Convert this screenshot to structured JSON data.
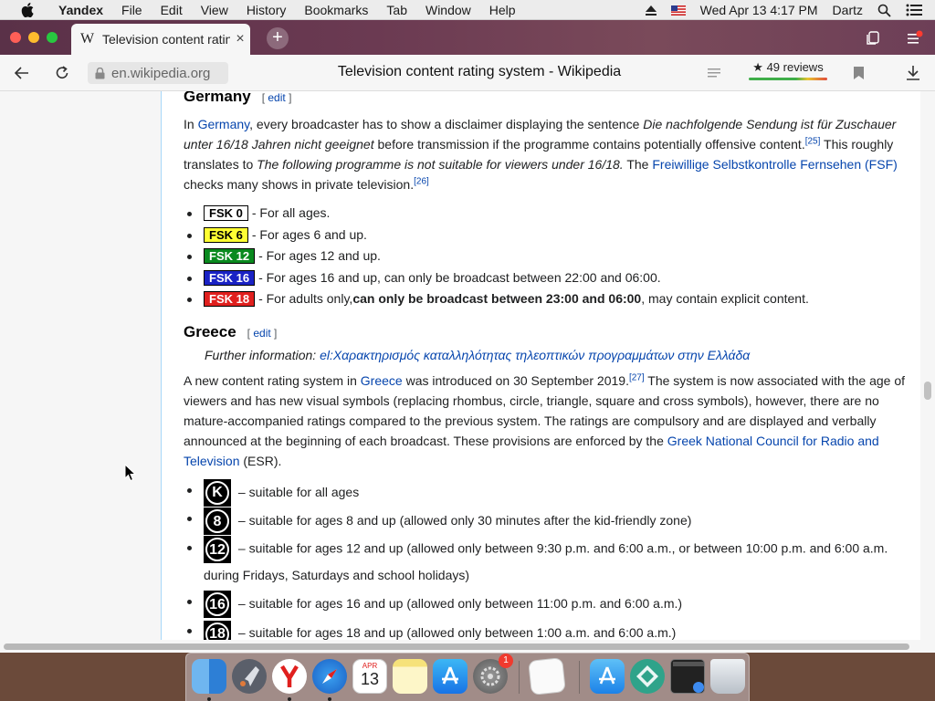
{
  "menubar": {
    "app_name": "Yandex",
    "items": [
      "File",
      "Edit",
      "View",
      "History",
      "Bookmarks",
      "Tab",
      "Window",
      "Help"
    ],
    "datetime": "Wed Apr 13  4:17 PM",
    "user": "Dartz"
  },
  "browser": {
    "tab_title": "Television content rating system - Wikipedia",
    "url": "en.wikipedia.org",
    "page_title": "Television content rating system - Wikipedia",
    "reviews": "★ 49 reviews"
  },
  "article": {
    "edit_label": "edit",
    "germany": {
      "heading": "Germany",
      "p_parts": {
        "in": "In ",
        "link_germany": "Germany",
        "t1": ", every broadcaster has to show a disclaimer displaying the sentence ",
        "quote_de": "Die nachfolgende Sendung ist für Zuschauer unter 16/18 Jahren nicht geeignet",
        "t2": " before transmission if the programme contains potentially offensive content.",
        "ref25": "[25]",
        "t3": " This roughly translates to ",
        "quote_en": "The following programme is not suitable for viewers under 16/18.",
        "t4": " The ",
        "link_fsf": "Freiwillige Selbstkontrolle Fernsehen (FSF)",
        "t5": " checks many shows in private television.",
        "ref26": "[26]"
      },
      "ratings": [
        {
          "label": "FSK 0",
          "bg": "#ffffff",
          "fg": "#000000",
          "desc": " - For all ages.",
          "bold": "",
          "tail": ""
        },
        {
          "label": "FSK 6",
          "bg": "#ffff33",
          "fg": "#000000",
          "desc": " - For ages 6 and up.",
          "bold": "",
          "tail": ""
        },
        {
          "label": "FSK 12",
          "bg": "#0a8a1f",
          "fg": "#ffffff",
          "desc": " - For ages 12 and up.",
          "bold": "",
          "tail": ""
        },
        {
          "label": "FSK 16",
          "bg": "#1a22c4",
          "fg": "#ffffff",
          "desc": " - For ages 16 and up, can only be broadcast between 22:00 and 06:00.",
          "bold": "",
          "tail": ""
        },
        {
          "label": "FSK 18",
          "bg": "#e0201e",
          "fg": "#ffffff",
          "desc": " - For adults only, ",
          "bold": "can only be broadcast between 23:00 and 06:00",
          "tail": ", may contain explicit content."
        }
      ]
    },
    "greece": {
      "heading": "Greece",
      "further_label": "Further information: ",
      "further_link": "el:Χαρακτηρισμός καταλληλότητας τηλεοπτικών προγραμμάτων στην Ελλάδα",
      "p_parts": {
        "t1": "A new content rating system in ",
        "link_greece": "Greece",
        "t2": " was introduced on 30 September 2019.",
        "ref27": "[27]",
        "t3": " The system is now associated with the age of viewers and has new visual symbols (replacing rhombus, circle, triangle, square and cross symbols), however, there are no mature-accompanied ratings compared to the previous system. The ratings are compulsory and are displayed and verbally announced at the beginning of each broadcast. These provisions are enforced by the ",
        "link_esr": "Greek National Council for Radio and Television",
        "t4": " (ESR)."
      },
      "ratings": [
        {
          "symbol": "K",
          "desc": " – suitable for all ages"
        },
        {
          "symbol": "8",
          "desc": " – suitable for ages 8 and up (allowed only 30 minutes after the kid-friendly zone)"
        },
        {
          "symbol": "12",
          "desc": " – suitable for ages 12 and up (allowed only between 9:30 p.m. and 6:00 a.m., or between 10:00 p.m. and 6:00 a.m. during Fridays, Saturdays and school holidays)"
        },
        {
          "symbol": "16",
          "desc": " – suitable for ages 16 and up (allowed only between 11:00 p.m. and 6:00 a.m.)"
        },
        {
          "symbol": "18",
          "desc": " – suitable for ages 18 and up (allowed only between 1:00 a.m. and 6:00 a.m.)"
        }
      ]
    }
  },
  "dock": {
    "apps": [
      "finder-icon",
      "launchpad-icon",
      "yandex-icon",
      "safari-icon",
      "calendar-icon",
      "notes-icon",
      "app-store-icon",
      "system-preferences-icon",
      "textedit-icon",
      "downloads-icon",
      "vpn-icon",
      "terminal-icon",
      "trash-icon"
    ],
    "calendar_month": "APR",
    "calendar_day": "13",
    "prefs_badge": "1"
  },
  "colors": {
    "link": "#0645ad",
    "menubar": "#ececec",
    "tab_bar": "#6b3a52"
  }
}
